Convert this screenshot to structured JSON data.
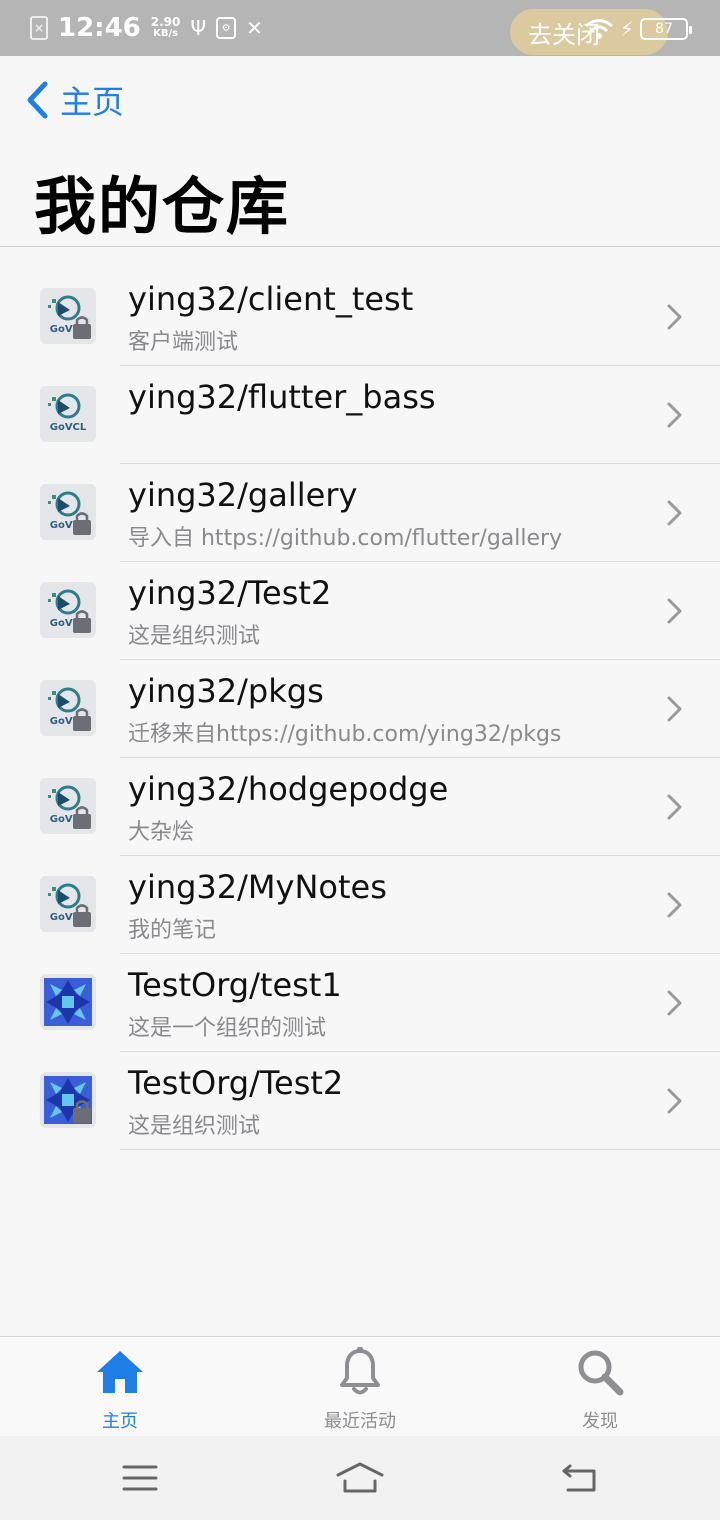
{
  "status_bar": {
    "time": "12:46",
    "speed_value": "2.90",
    "speed_unit": "KB/s",
    "overlay_text": "去关闭",
    "battery": "87"
  },
  "header": {
    "back_label": "主页",
    "title": "我的仓库"
  },
  "repos": [
    {
      "name": "ying32/client_test",
      "description": "客户端测试",
      "avatar": "govcl-lock"
    },
    {
      "name": "ying32/flutter_bass",
      "description": "",
      "avatar": "govcl"
    },
    {
      "name": "ying32/gallery",
      "description": "导入自 https://github.com/flutter/gallery",
      "avatar": "govcl-lock"
    },
    {
      "name": "ying32/Test2",
      "description": "这是组织测试",
      "avatar": "govcl-lock"
    },
    {
      "name": "ying32/pkgs",
      "description": "迁移来自https://github.com/ying32/pkgs",
      "avatar": "govcl-lock"
    },
    {
      "name": "ying32/hodgepodge",
      "description": "大杂烩",
      "avatar": "govcl-lock"
    },
    {
      "name": "ying32/MyNotes",
      "description": "我的笔记",
      "avatar": "govcl-lock"
    },
    {
      "name": "TestOrg/test1",
      "description": "这是一个组织的测试",
      "avatar": "testorg"
    },
    {
      "name": "TestOrg/Test2",
      "description": "这是组织测试",
      "avatar": "testorg-lock"
    }
  ],
  "tabs": [
    {
      "label": "主页",
      "icon": "home-icon",
      "active": true
    },
    {
      "label": "最近活动",
      "icon": "bell-icon",
      "active": false
    },
    {
      "label": "发现",
      "icon": "search-icon",
      "active": false
    }
  ],
  "colors": {
    "accent": "#1f7ee8",
    "inactive": "#8e8e93",
    "secondary_text": "#8a8a8e"
  }
}
